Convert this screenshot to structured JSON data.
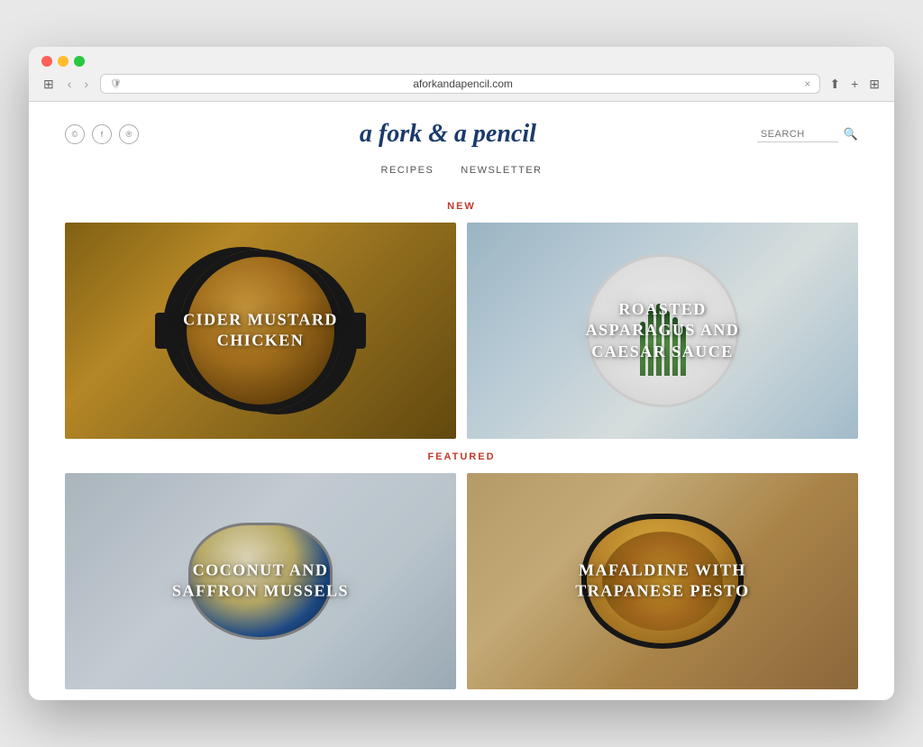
{
  "browser": {
    "url": "aforkandapencil.com",
    "tab_label": "aforkandapencil.com",
    "close_tab": "×"
  },
  "site": {
    "title": "a fork & a pencil",
    "social": {
      "icons": [
        "©",
        "f",
        "®"
      ]
    },
    "search_placeholder": "SEARCH",
    "nav": [
      {
        "label": "RECIPES"
      },
      {
        "label": "NEWSLETTER"
      }
    ],
    "sections": {
      "new_label": "NEW",
      "featured_label": "FEATURED"
    },
    "new_recipes": [
      {
        "title": "CIDER MUSTARD\nCHICKEN",
        "card_class": "card-cider"
      },
      {
        "title": "ROASTED\nASPARAGUS AND\nCAESAR SAUCE",
        "card_class": "card-asparagus"
      }
    ],
    "featured_recipes": [
      {
        "title": "COCONUT AND\nSAFFRON MUSSELS",
        "card_class": "card-mussels"
      },
      {
        "title": "MAFALDINE WITH\nTRAPANESE PESTO",
        "card_class": "card-pasta"
      }
    ]
  }
}
